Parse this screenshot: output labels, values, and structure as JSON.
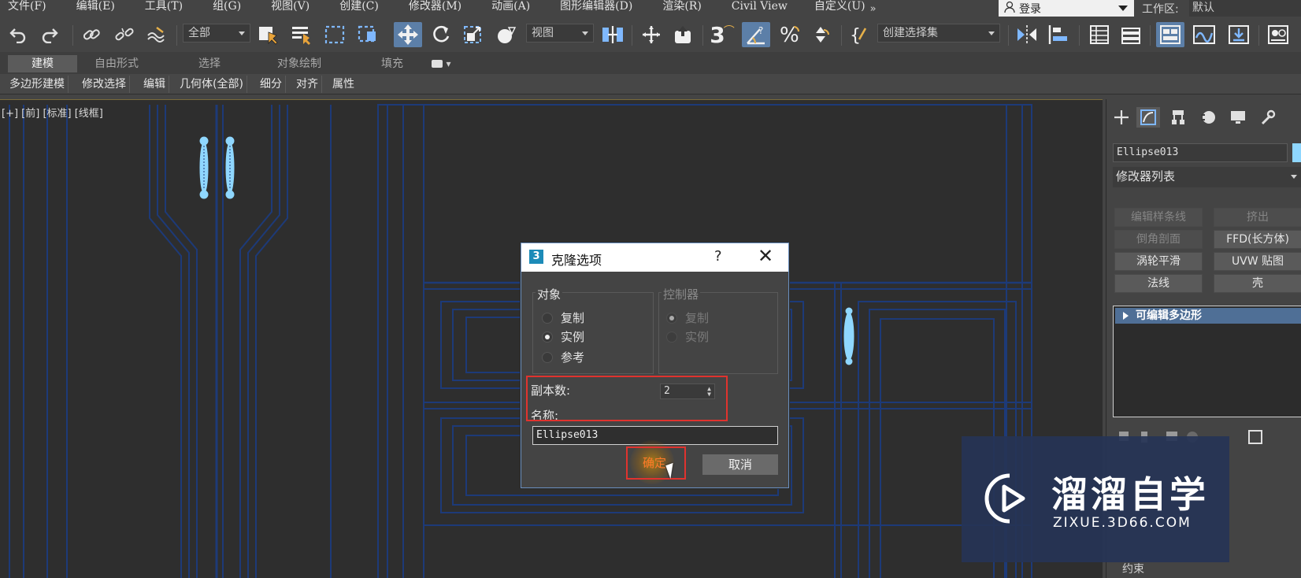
{
  "menubar": {
    "items": [
      "文件(F)",
      "编辑(E)",
      "工具(T)",
      "组(G)",
      "视图(V)",
      "创建(C)",
      "修改器(M)",
      "动画(A)",
      "图形编辑器(D)",
      "渲染(R)",
      "Civil View",
      "自定义(U)"
    ],
    "more": "»",
    "login": "登录",
    "workspace_label": "工作区:",
    "workspace_value": "默认"
  },
  "toolbar": {
    "filter_dropdown": "全部",
    "coord_dropdown": "视图",
    "selection_set_dropdown": "创建选择集",
    "snap_number": "3",
    "icons": [
      "undo-icon",
      "redo-icon",
      "link-icon",
      "unlink-icon",
      "bind-spacewarp-icon",
      "select-object-icon",
      "select-by-name-icon",
      "rect-select-icon",
      "window-crossing-icon",
      "move-icon",
      "rotate-icon",
      "scale-icon",
      "placement-icon",
      "select-filter-icon",
      "pivot-icon",
      "manipulate-icon",
      "snap-icon",
      "angle-snap-icon",
      "percent-snap-icon",
      "spinner-snap-icon",
      "edit-named-sets-icon",
      "mirror-icon",
      "align-icon",
      "scene-explorer-icon",
      "layer-explorer-icon",
      "ribbon-toggle-icon",
      "curve-editor-icon",
      "schematic-icon",
      "material-editor-icon"
    ]
  },
  "ribbon": {
    "tabs": [
      "建模",
      "自由形式",
      "选择",
      "对象绘制",
      "填充"
    ],
    "extra": "▾",
    "sub_items": [
      "多边形建模",
      "修改选择",
      "编辑",
      "几何体(全部)",
      "细分",
      "对齐",
      "属性"
    ]
  },
  "viewport": {
    "label": "[+] [前] [标准] [线框]"
  },
  "command_panel": {
    "object_name": "Ellipse013",
    "modifier_list": "修改器列表",
    "buttons": [
      {
        "label": "编辑样条线",
        "enabled": false
      },
      {
        "label": "挤出",
        "enabled": false
      },
      {
        "label": "倒角剖面",
        "enabled": false
      },
      {
        "label": "FFD(长方体)",
        "enabled": true
      },
      {
        "label": "涡轮平滑",
        "enabled": true
      },
      {
        "label": "UVW 贴图",
        "enabled": true
      },
      {
        "label": "法线",
        "enabled": true
      },
      {
        "label": "壳",
        "enabled": true
      }
    ],
    "stack_item": "可编辑多边形",
    "bottom_item": "约束"
  },
  "dialog": {
    "title": "克隆选项",
    "help": "?",
    "close": "✕",
    "logo": "3",
    "object_group": {
      "title": "对象",
      "options": [
        "复制",
        "实例",
        "参考"
      ],
      "selected": "实例"
    },
    "controller_group": {
      "title": "控制器",
      "options": [
        "复制",
        "实例"
      ],
      "selected": "复制"
    },
    "copies_label": "副本数:",
    "copies_value": "2",
    "name_label": "名称:",
    "name_value": "Ellipse013",
    "ok": "确定",
    "cancel": "取消"
  },
  "watermark": {
    "brand_cn": "溜溜自学",
    "brand_en": "ZIXUE.3D66.COM"
  },
  "colors": {
    "accent_blue": "#4f6f96",
    "highlight_red": "#e0332e",
    "wireframe_blue": "#1d3a78",
    "selected_cyan": "#8fd7ff"
  }
}
